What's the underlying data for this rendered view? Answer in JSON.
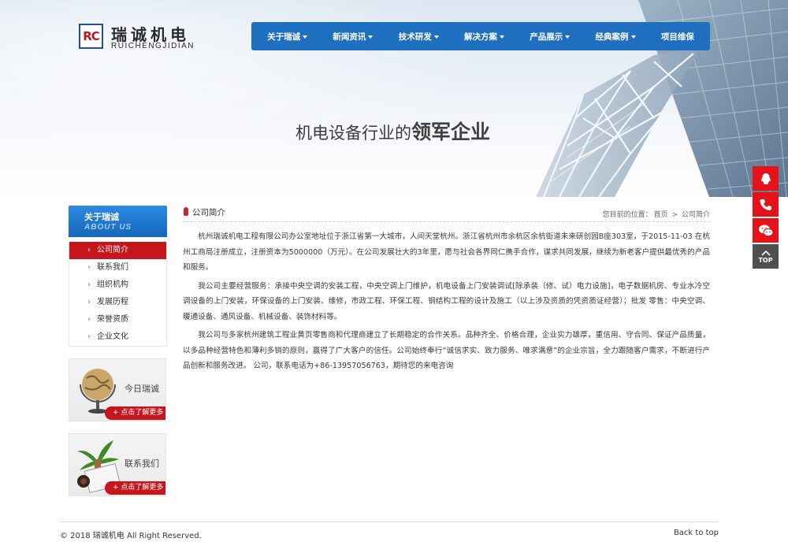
{
  "brand": {
    "logo_mark": "RC",
    "name_cn": "瑞诚机电",
    "name_en": "RUICHENGJIDIAN"
  },
  "nav": {
    "items": [
      {
        "label": "关于瑞诚",
        "has_caret": true
      },
      {
        "label": "新闻资讯",
        "has_caret": true
      },
      {
        "label": "技术研发",
        "has_caret": true
      },
      {
        "label": "解决方案",
        "has_caret": true
      },
      {
        "label": "产品展示",
        "has_caret": true
      },
      {
        "label": "经典案例",
        "has_caret": true
      },
      {
        "label": "项目维保",
        "has_caret": false
      }
    ]
  },
  "banner": {
    "slogan_thin": "机电设备行业的",
    "slogan_strong": "领军企业"
  },
  "sidebar": {
    "title_cn": "关于瑞诚",
    "title_en": "ABOUT US",
    "items": [
      {
        "label": "公司简介",
        "active": true
      },
      {
        "label": "联系我们",
        "active": false
      },
      {
        "label": "组织机构",
        "active": false
      },
      {
        "label": "发展历程",
        "active": false
      },
      {
        "label": "荣誉资质",
        "active": false
      },
      {
        "label": "企业文化",
        "active": false
      }
    ],
    "promos": [
      {
        "label": "今日瑞诚",
        "more": "+ 点击了解更多"
      },
      {
        "label": "联系我们",
        "more": "+ 点击了解更多"
      }
    ]
  },
  "content": {
    "title": "公司简介",
    "breadcrumb": {
      "prefix": "您目前的位置：",
      "home": "首页",
      "separator": ">",
      "current": "公司简介"
    },
    "paragraphs": [
      "杭州瑞诚机电工程有限公司办公室地址位于浙江省第一大城市，人间天堂杭州。浙江省杭州市余杭区余杭街道未来研创园B座303室，于2015-11-03 在杭州工商局注册成立，注册资本为5000000（万元）。在公司发展壮大的3年里，愿与社会各界同仁携手合作，谋求共同发展，继续为新老客户提供最优秀的产品和服务。",
      "我公司主要经营服务：承接中央空调的安装工程，中央空调上门维护，机电设备上门安装调试[除承装（修、试）电力设施]，电子数据机房、专业水冷空调设备的上门安装，环保设备的上门安装、维修，市政工程、环保工程、钢结构工程的设计及施工（以上涉及资质的凭资质证经营）；批发 零售：中央空调、暖通设备、通风设备、机械设备、装饰材料等。",
      "我公司与多家杭州建筑工程业黄页零售商和代理商建立了长期稳定的合作关系。品种齐全、价格合理，企业实力雄厚，重信用、守合同、保证产品质量，以多品种经营特色和薄利多销的原则，赢得了广大客户的信任。公司始终奉行“诚信求实、致力服务、唯求满意”的企业宗旨，全力跟随客户需求，不断进行产品创新和服务改进。 公司，联系电话为+86-13957056763，期待您的来电咨询"
    ]
  },
  "footer": {
    "copyright": "© 2018 瑞诚机电 All Right Reserved.",
    "back_to_top": "Back to top"
  },
  "float_bar": {
    "top_label": "TOP",
    "icons": [
      "qq-icon",
      "phone-icon",
      "wechat-icon",
      "arrow-up-icon"
    ]
  },
  "colors": {
    "nav_blue": "#1f6fc0",
    "accent_red": "#c5161e",
    "float_red": "#e5121a"
  }
}
